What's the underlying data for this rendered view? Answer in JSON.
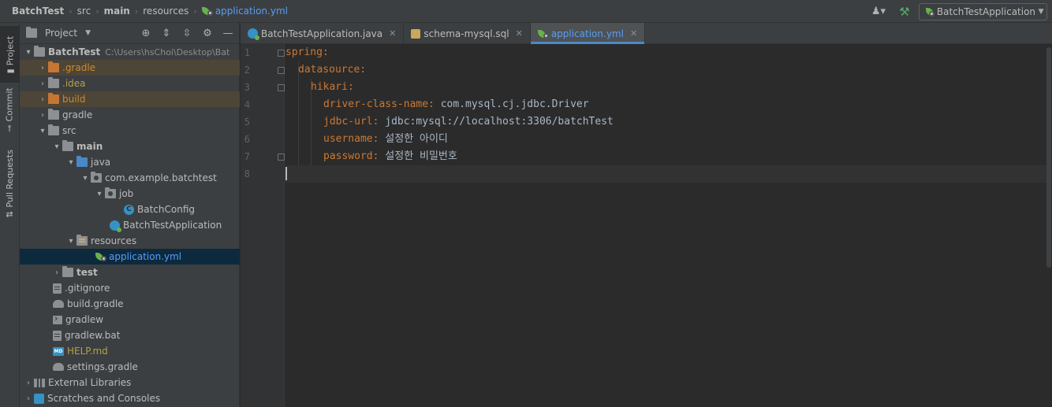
{
  "breadcrumbs": [
    "BatchTest",
    "src",
    "main",
    "resources",
    "application.yml"
  ],
  "run_config": "BatchTestApplication",
  "toolwindow_tabs": [
    "Project",
    "Commit",
    "Pull Requests"
  ],
  "project_panel": {
    "title": "Project",
    "tree": [
      {
        "label": "BatchTest",
        "path_hint": "C:\\Users\\hsChoi\\Desktop\\Bat"
      },
      {
        "label": ".gradle"
      },
      {
        "label": ".idea"
      },
      {
        "label": "build"
      },
      {
        "label": "gradle"
      },
      {
        "label": "src"
      },
      {
        "label": "main"
      },
      {
        "label": "java"
      },
      {
        "label": "com.example.batchtest"
      },
      {
        "label": "job"
      },
      {
        "label": "BatchConfig"
      },
      {
        "label": "BatchTestApplication"
      },
      {
        "label": "resources"
      },
      {
        "label": "application.yml"
      },
      {
        "label": "test"
      },
      {
        "label": ".gitignore"
      },
      {
        "label": "build.gradle"
      },
      {
        "label": "gradlew"
      },
      {
        "label": "gradlew.bat"
      },
      {
        "label": "HELP.md"
      },
      {
        "label": "settings.gradle"
      },
      {
        "label": "External Libraries"
      },
      {
        "label": "Scratches and Consoles"
      }
    ]
  },
  "editor": {
    "tabs": [
      {
        "label": "BatchTestApplication.java"
      },
      {
        "label": "schema-mysql.sql"
      },
      {
        "label": "application.yml"
      }
    ],
    "line_numbers": [
      "1",
      "2",
      "3",
      "4",
      "5",
      "6",
      "7",
      "8"
    ],
    "lines": [
      {
        "key": "spring",
        "value": ""
      },
      {
        "key": "datasource",
        "value": ""
      },
      {
        "key": "hikari",
        "value": ""
      },
      {
        "key": "driver-class-name",
        "value": "com.mysql.cj.jdbc.Driver"
      },
      {
        "key": "jdbc-url",
        "value": "jdbc:mysql://localhost:3306/batchTest"
      },
      {
        "key": "username",
        "value": "설정한 아이디"
      },
      {
        "key": "password",
        "value": "설정한 비밀번호"
      }
    ]
  }
}
